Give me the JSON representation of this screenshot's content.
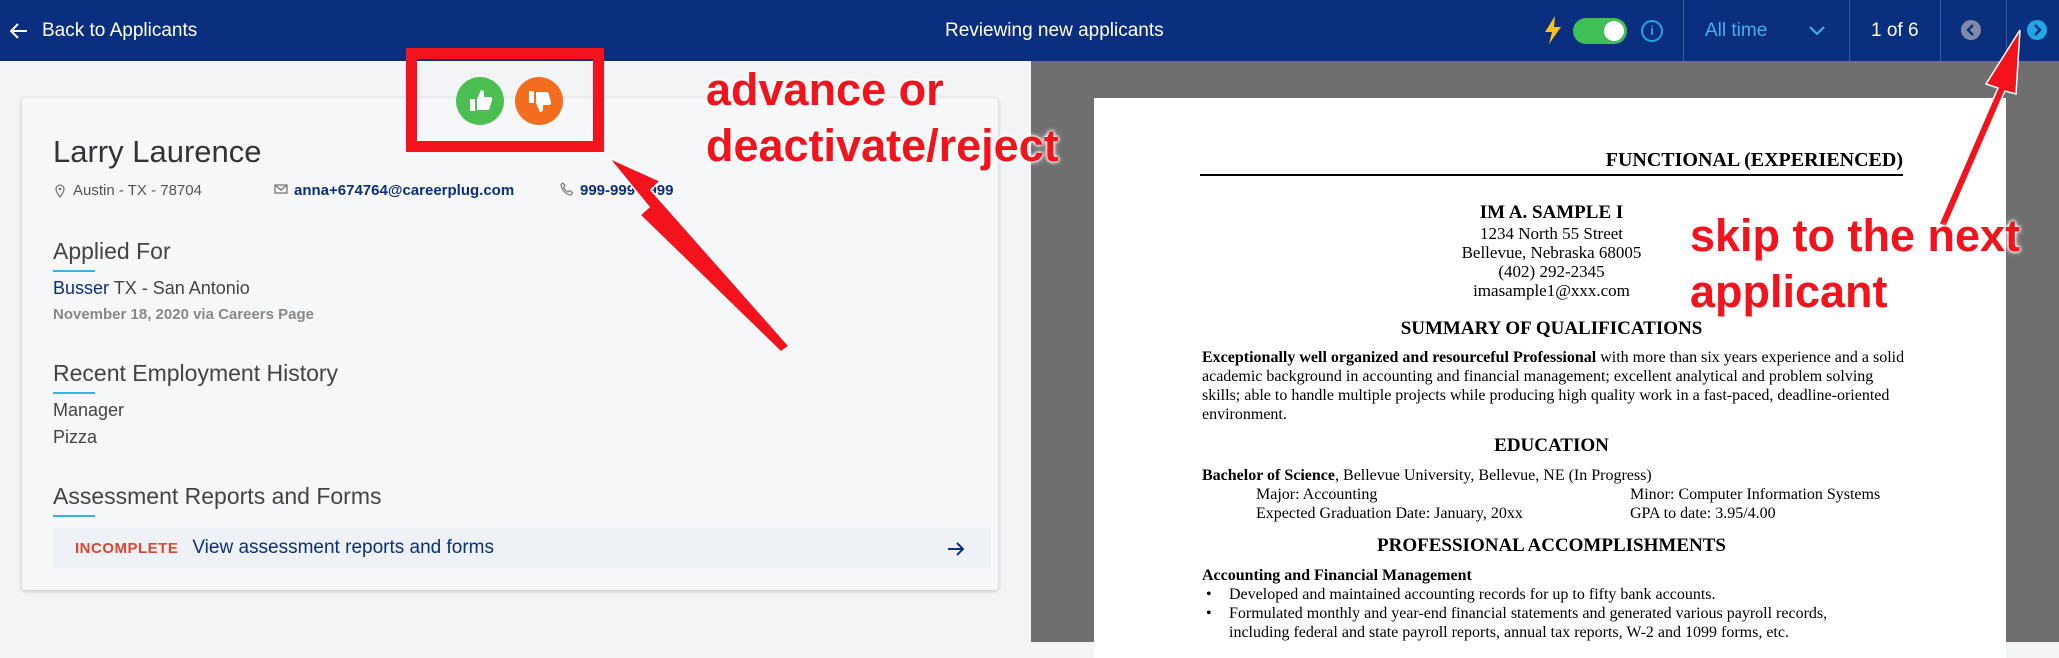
{
  "topbar": {
    "back_label": "Back to Applicants",
    "title": "Reviewing new applicants",
    "auto_advance_toggle": "on",
    "date_range": "All time",
    "counter": "1 of 6",
    "icons": [
      "arrow-left-icon",
      "lightning-icon",
      "info-icon",
      "chevron-down-icon",
      "prev-circle-icon",
      "next-circle-icon"
    ]
  },
  "applicant": {
    "name": "Larry Laurence",
    "location": "Austin - TX - 78704",
    "email": "anna+674764@careerplug.com",
    "phone": "999-999-9999"
  },
  "applied_for": {
    "heading": "Applied For",
    "job": "Busser",
    "job_location": "TX - San Antonio",
    "date_source": "November 18, 2020 via Careers Page"
  },
  "employment": {
    "heading": "Recent Employment History",
    "title": "Manager",
    "company": "Pizza"
  },
  "assessments": {
    "heading": "Assessment Reports and Forms",
    "status": "INCOMPLETE",
    "link": "View assessment reports and forms"
  },
  "actions": {
    "advance_icon": "thumbs-up-icon",
    "reject_icon": "thumbs-down-icon"
  },
  "annotations": {
    "advance_line1": "advance or",
    "advance_line2": "deactivate/reject",
    "skip_line1": "skip to the next",
    "skip_line2": "applicant",
    "color": "#f2131d"
  },
  "resume": {
    "header": "FUNCTIONAL (EXPERIENCED)",
    "name": "IM A. SAMPLE I",
    "address": "1234 North 55 Street",
    "city": "Bellevue, Nebraska 68005",
    "phone": "(402) 292-2345",
    "email": "imasample1@xxx.com",
    "summary_heading": "SUMMARY OF QUALIFICATIONS",
    "summary_bold": "Exceptionally well organized and resourceful Professional",
    "summary_rest": " with more than six years experience and a solid academic background in accounting and financial management; excellent analytical and problem solving skills; able to handle multiple projects while producing high quality work in a fast-paced, deadline-oriented environment.",
    "education_heading": "EDUCATION",
    "degree_bold": "Bachelor of Science",
    "degree_rest": ", Bellevue University, Bellevue, NE (In Progress)",
    "major": "Major:  Accounting",
    "minor": "Minor:  Computer Information Systems",
    "grad": "Expected Graduation Date:  January, 20xx",
    "gpa": "GPA to date:  3.95/4.00",
    "accomplishments_heading": "PROFESSIONAL ACCOMPLISHMENTS",
    "accounting_heading": "Accounting and Financial Management",
    "bullet1": "Developed and maintained accounting records for up to fifty bank accounts.",
    "bullet2": "Formulated monthly and year-end financial statements and generated various payroll records, including federal and state payroll reports, annual tax reports, W-2 and 1099 forms, etc."
  },
  "colors": {
    "topbar": "#0b2f7f",
    "accent": "#36b3e6",
    "advance": "#4cbf52",
    "reject": "#f36d1f",
    "incomplete": "#e0452e"
  }
}
